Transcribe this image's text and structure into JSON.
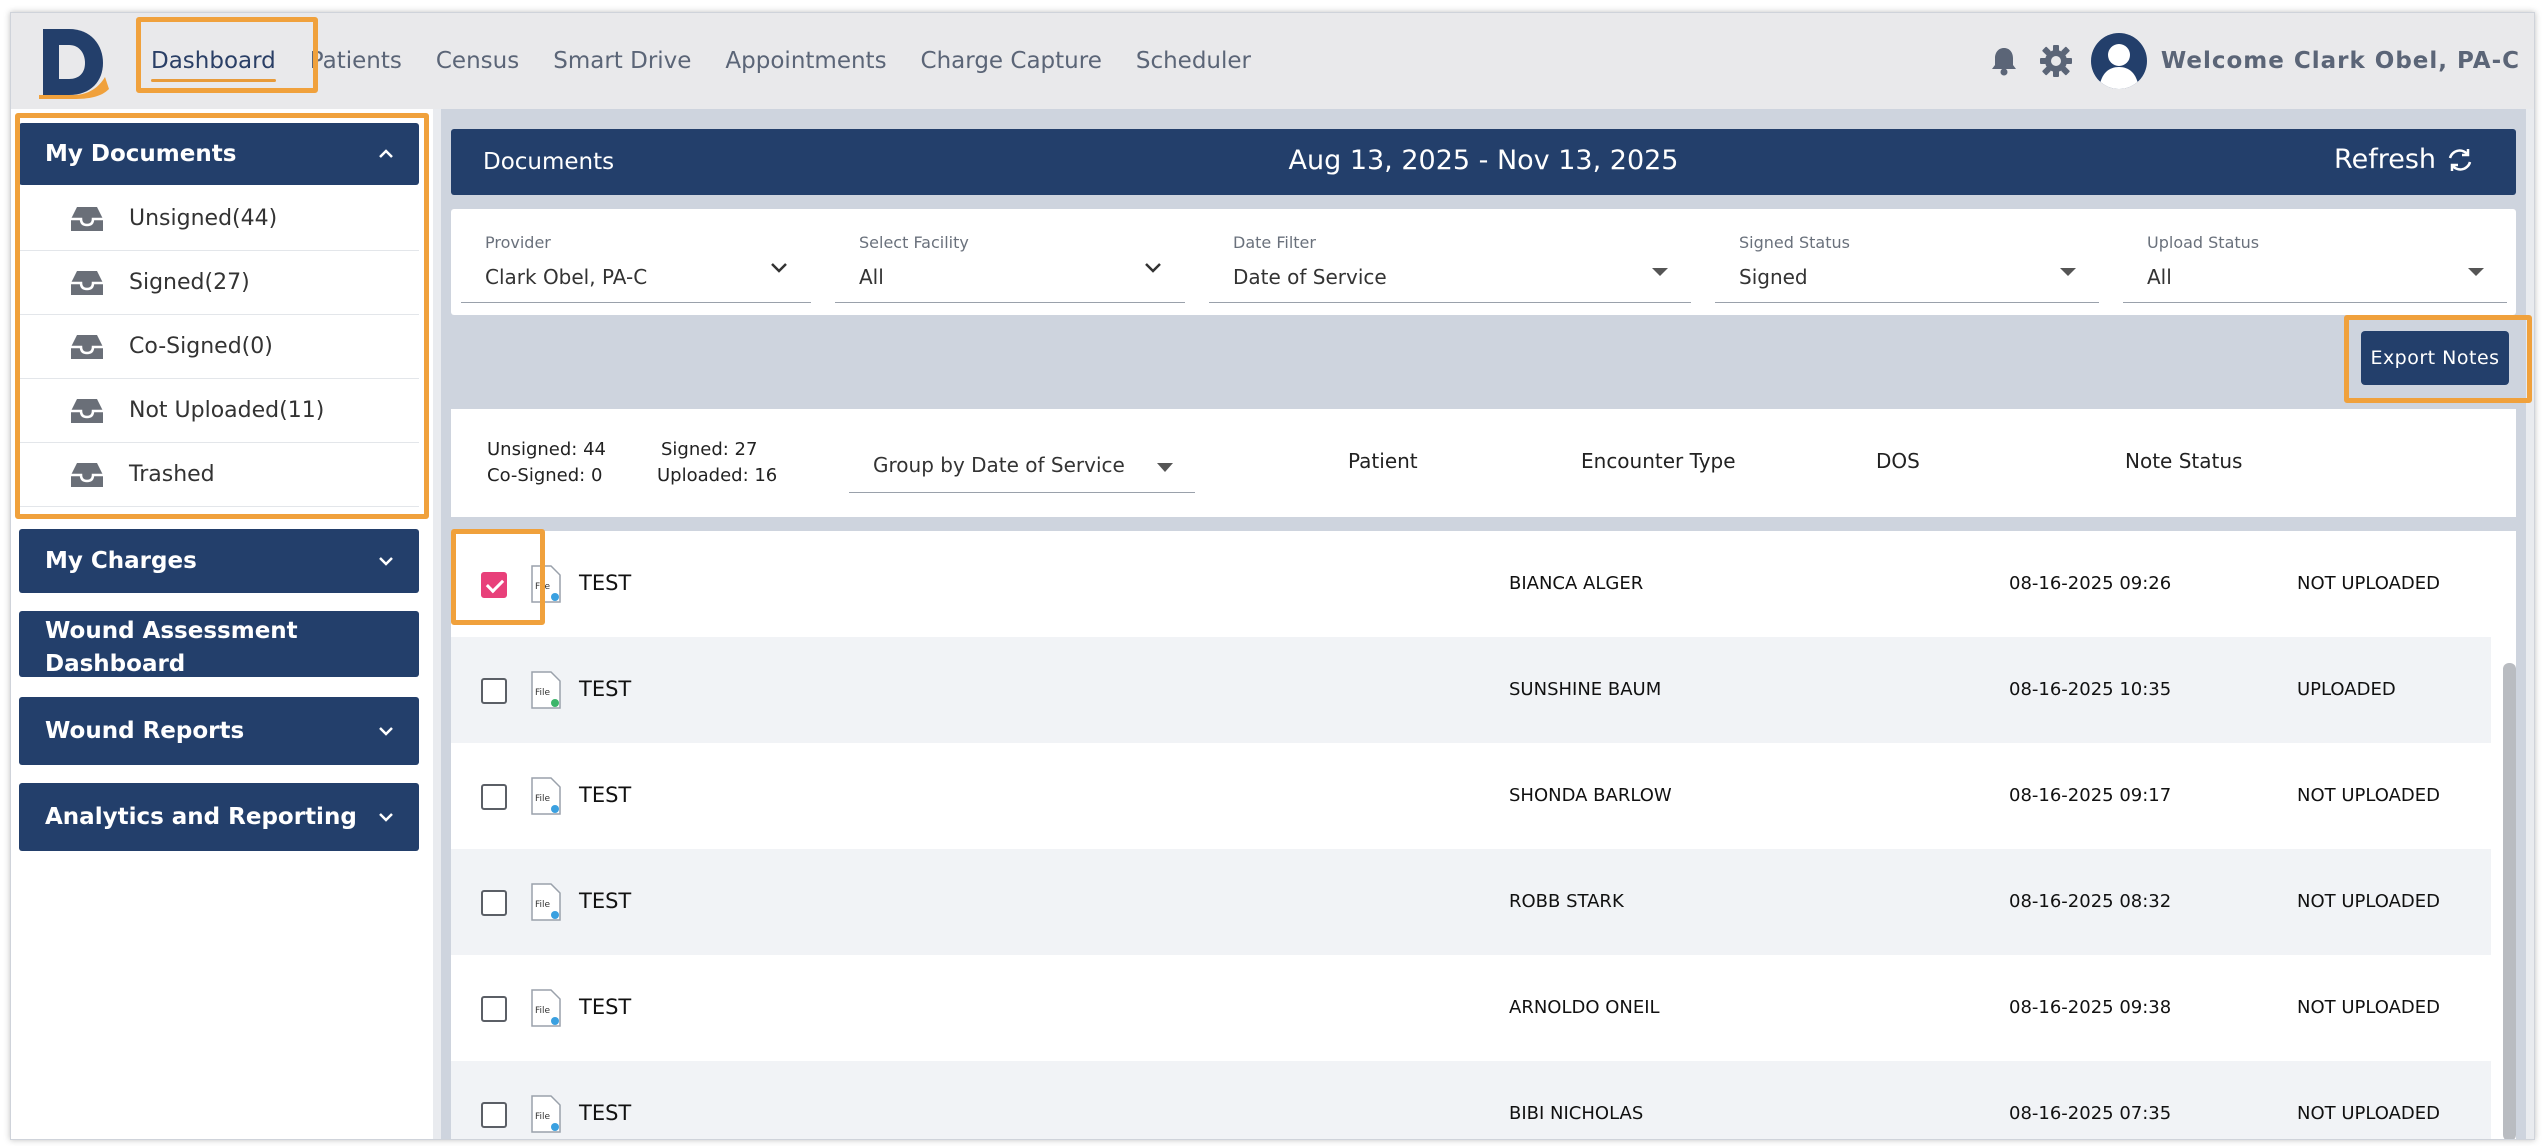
{
  "nav": {
    "items": [
      "Dashboard",
      "Patients",
      "Census",
      "Smart Drive",
      "Appointments",
      "Charge Capture",
      "Scheduler"
    ],
    "welcome": "Welcome Clark Obel, PA-C"
  },
  "sidebar": {
    "my_documents": "My Documents",
    "doc_items": [
      "Unsigned(44)",
      "Signed(27)",
      "Co-Signed(0)",
      "Not Uploaded(11)",
      "Trashed"
    ],
    "my_charges": "My Charges",
    "wound_dashboard_line1": "Wound Assessment",
    "wound_dashboard_line2": "Dashboard",
    "wound_reports": "Wound Reports",
    "analytics": "Analytics and Reporting"
  },
  "documents": {
    "title": "Documents",
    "date_range": "Aug 13, 2025 - Nov 13, 2025",
    "refresh": "Refresh"
  },
  "filters": {
    "provider_label": "Provider",
    "provider_value": "Clark Obel, PA-C",
    "facility_label": "Select Facility",
    "facility_value": "All",
    "date_label": "Date Filter",
    "date_value": "Date of Service",
    "signed_label": "Signed Status",
    "signed_value": "Signed",
    "upload_label": "Upload Status",
    "upload_value": "All"
  },
  "export_label": "Export Notes",
  "summary": {
    "unsigned": "Unsigned: 44",
    "signed": "Signed: 27",
    "cosigned": "Co-Signed: 0",
    "uploaded": "Uploaded: 16",
    "group_by": "Group by Date of Service"
  },
  "columns": {
    "patient": "Patient",
    "encounter": "Encounter Type",
    "dos": "DOS",
    "status": "Note Status"
  },
  "file_icon_text": "File",
  "rows": [
    {
      "name": "TEST",
      "patient": "BIANCA ALGER",
      "dos": "08-16-2025 09:26",
      "status": "NOT UPLOADED",
      "checked": true
    },
    {
      "name": "TEST",
      "patient": "SUNSHINE BAUM",
      "dos": "08-16-2025 10:35",
      "status": "UPLOADED",
      "checked": false
    },
    {
      "name": "TEST",
      "patient": "SHONDA BARLOW",
      "dos": "08-16-2025 09:17",
      "status": "NOT UPLOADED",
      "checked": false
    },
    {
      "name": "TEST",
      "patient": "ROBB STARK",
      "dos": "08-16-2025 08:32",
      "status": "NOT UPLOADED",
      "checked": false
    },
    {
      "name": "TEST",
      "patient": "ARNOLDO ONEIL",
      "dos": "08-16-2025 09:38",
      "status": "NOT UPLOADED",
      "checked": false
    },
    {
      "name": "TEST",
      "patient": "BIBI NICHOLAS",
      "dos": "08-16-2025 07:35",
      "status": "NOT UPLOADED",
      "checked": false
    }
  ],
  "colors": {
    "navy": "#233f6b",
    "highlight": "#f0a13c",
    "checkbox": "#e8407a",
    "logo_orange": "#f0a13c"
  },
  "icons": [
    "logo-icon",
    "bell-icon",
    "gear-icon",
    "avatar-icon",
    "chevron-up-icon",
    "chevron-down-icon",
    "tray-icon",
    "refresh-icon",
    "file-icon"
  ]
}
